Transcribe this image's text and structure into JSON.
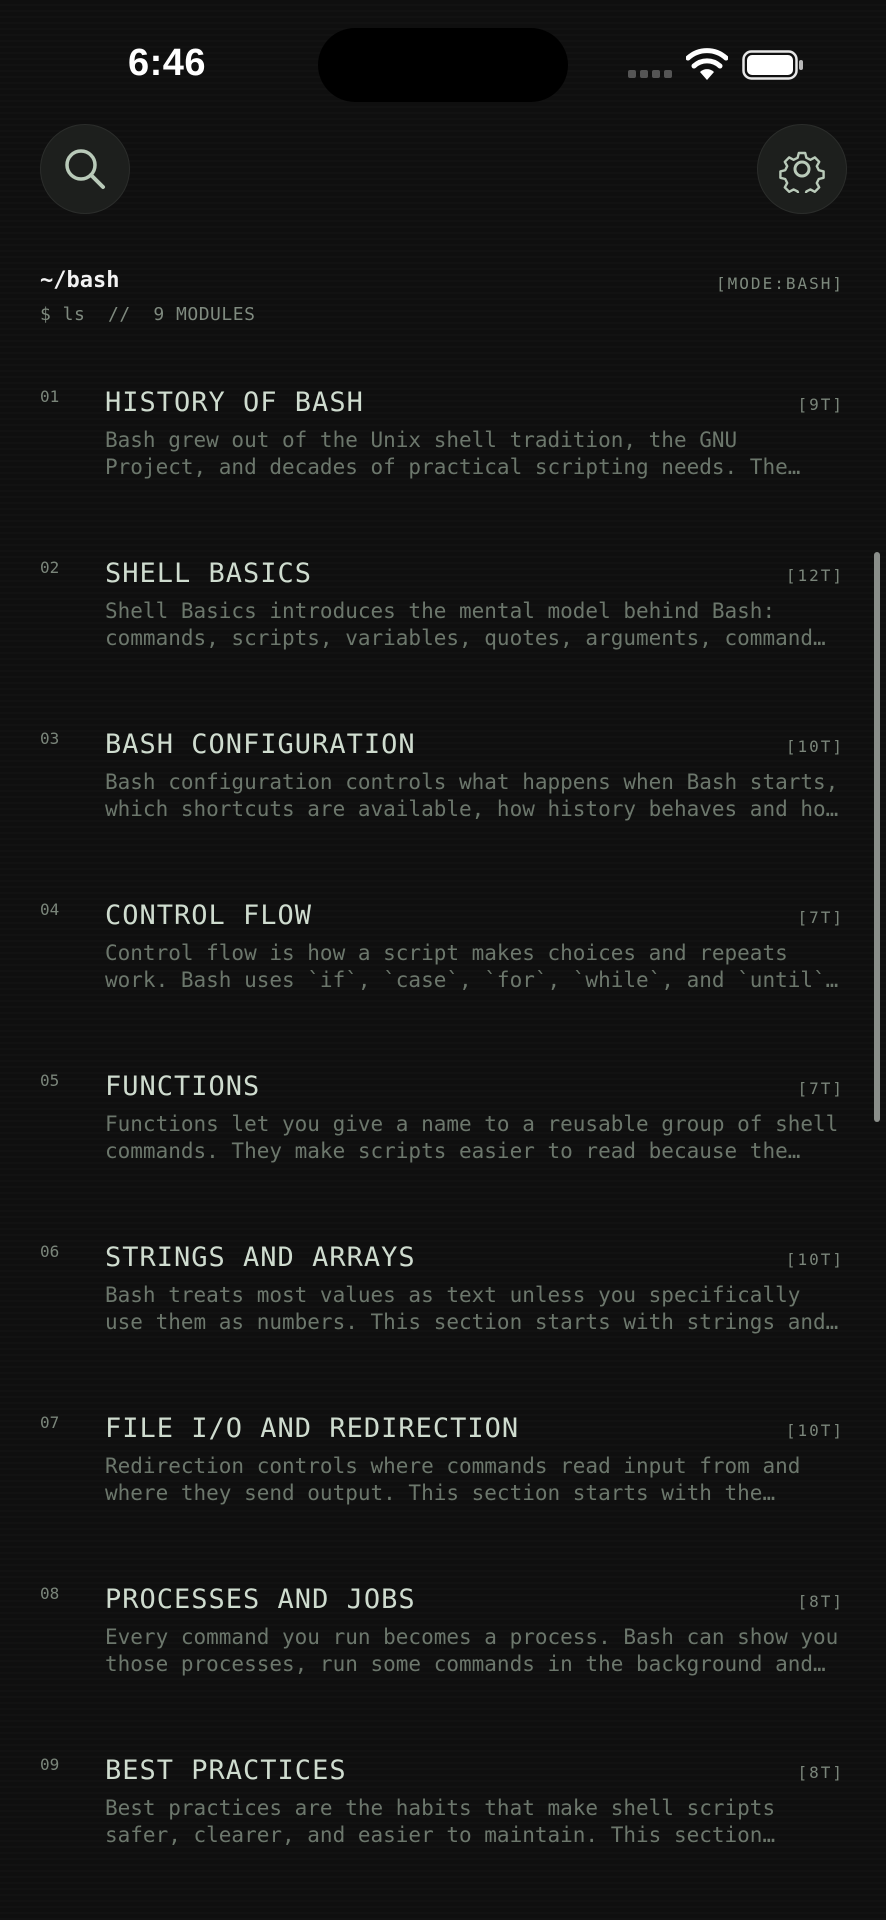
{
  "status_bar": {
    "time": "6:46"
  },
  "header": {
    "path": "~/bash",
    "mode": "[MODE:BASH]",
    "command": "$ ls  //  9 MODULES"
  },
  "colors": {
    "background": "#0f0f0f",
    "title": "#cfdccf",
    "muted": "#6c776c"
  },
  "icons": {
    "search": "search-icon",
    "settings": "gear-icon"
  },
  "modules": [
    {
      "num": "01",
      "title": "HISTORY OF BASH",
      "count": "[9T]",
      "desc": "Bash grew out of the Unix shell tradition, the GNU Project, and decades of practical scripting needs. The shell has evolved over time into the default tool for automation."
    },
    {
      "num": "02",
      "title": "SHELL BASICS",
      "count": "[12T]",
      "desc": "Shell Basics introduces the mental model behind Bash: commands, scripts, variables, quotes, arguments, command substitution and exit codes."
    },
    {
      "num": "03",
      "title": "BASH CONFIGURATION",
      "count": "[10T]",
      "desc": "Bash configuration controls what happens when Bash starts, which shortcuts are available, how history behaves and how the prompt looks."
    },
    {
      "num": "04",
      "title": "CONTROL FLOW",
      "count": "[7T]",
      "desc": "Control flow is how a script makes choices and repeats work. Bash uses `if`, `case`, `for`, `while`, and `until` to control execution."
    },
    {
      "num": "05",
      "title": "FUNCTIONS",
      "count": "[7T]",
      "desc": "Functions let you give a name to a reusable group of shell commands. They make scripts easier to read because the logic is grouped."
    },
    {
      "num": "06",
      "title": "STRINGS AND ARRAYS",
      "count": "[10T]",
      "desc": "Bash treats most values as text unless you specifically use them as numbers. This section starts with strings and then covers arrays."
    },
    {
      "num": "07",
      "title": "FILE I/O AND REDIRECTION",
      "count": "[10T]",
      "desc": "Redirection controls where commands read input from and where they send output. This section starts with the standard streams."
    },
    {
      "num": "08",
      "title": "PROCESSES AND JOBS",
      "count": "[8T]",
      "desc": "Every command you run becomes a process. Bash can show you those processes, run some commands in the background and manage jobs."
    },
    {
      "num": "09",
      "title": "BEST PRACTICES",
      "count": "[8T]",
      "desc": "Best practices are the habits that make shell scripts safer, clearer, and easier to maintain. This section collects the essentials."
    }
  ]
}
